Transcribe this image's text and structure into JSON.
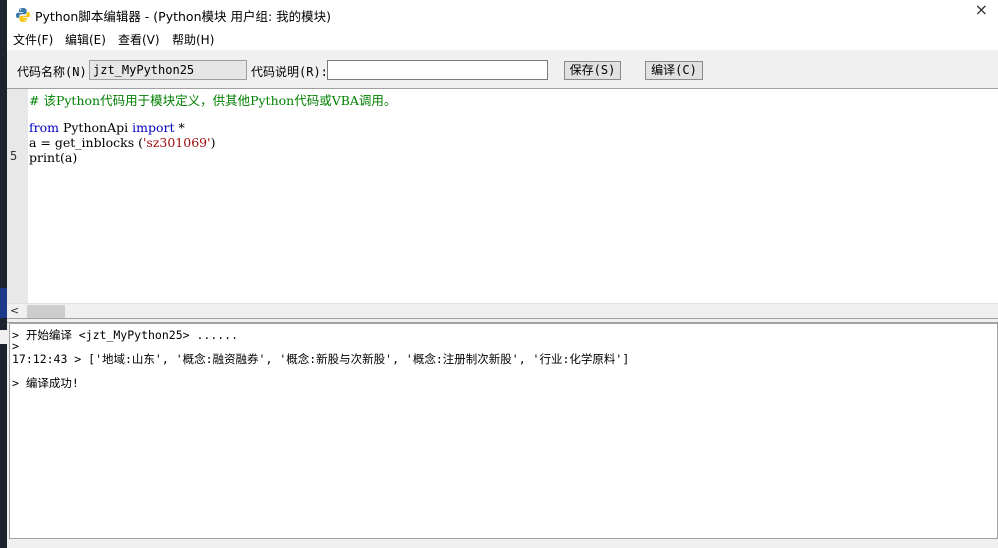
{
  "window": {
    "title": "Python脚本编辑器 - (Python模块 用户组: 我的模块)",
    "app_icon": "python-icon",
    "close_glyph": "×"
  },
  "menu": {
    "items": [
      {
        "label": "文件(F)"
      },
      {
        "label": "编辑(E)"
      },
      {
        "label": "查看(V)"
      },
      {
        "label": "帮助(H)"
      }
    ]
  },
  "toolbar": {
    "code_name_label": "代码名称(N):",
    "code_name_value": "jzt_MyPython25",
    "code_desc_label": "代码说明(R):",
    "code_desc_value": "",
    "save_label": "保存(S)",
    "compile_label": "编译(C)"
  },
  "editor": {
    "line_number_shown": "5",
    "lines": {
      "comment": "# 该Python代码用于模块定义，供其他Python代码或VBA调用。",
      "from_kw": "from",
      "from_mod": " PythonApi ",
      "import_kw": "import",
      "import_rest": " *",
      "assign_prefix": "a = get_inblocks (",
      "assign_string": "'sz301069'",
      "assign_suffix": ")",
      "print_line": "print(a)"
    },
    "scroll_left_glyph": "<"
  },
  "output": {
    "lines": [
      "> 开始编译 <jzt_MyPython25> ......",
      ">",
      "17:12:43 > ['地域:山东', '概念:融资融券', '概念:新股与次新股', '概念:注册制次新股', '行业:化学原料']",
      "> 编译成功!"
    ]
  },
  "colors": {
    "comment": "#008000",
    "keyword": "#0000c0",
    "string": "#a01010"
  }
}
